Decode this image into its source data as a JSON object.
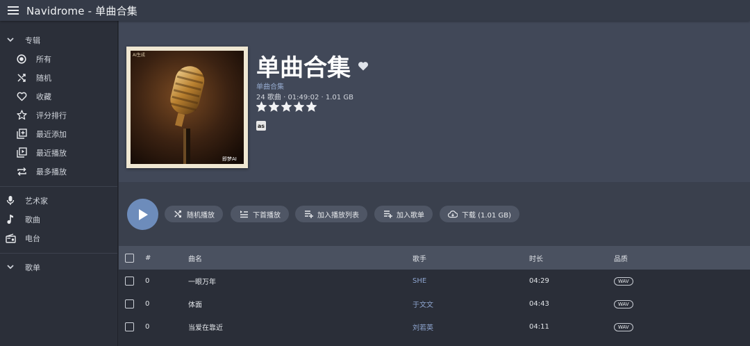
{
  "app": {
    "title": "Navidrome - 单曲合集"
  },
  "sidebar": {
    "albums_section": "专辑",
    "album_items": [
      {
        "label": "所有",
        "icon": "radio-selected-icon"
      },
      {
        "label": "随机",
        "icon": "shuffle-icon"
      },
      {
        "label": "收藏",
        "icon": "heart-outline-icon"
      },
      {
        "label": "评分排行",
        "icon": "star-outline-icon"
      },
      {
        "label": "最近添加",
        "icon": "library-add-icon"
      },
      {
        "label": "最近播放",
        "icon": "video-library-icon"
      },
      {
        "label": "最多播放",
        "icon": "repeat-icon"
      }
    ],
    "top_items": [
      {
        "label": "艺术家",
        "icon": "microphone-icon"
      },
      {
        "label": "歌曲",
        "icon": "music-note-icon"
      },
      {
        "label": "电台",
        "icon": "radio-icon"
      }
    ],
    "playlists_section": "歌单"
  },
  "album": {
    "title": "单曲合集",
    "artist": "单曲合集",
    "meta": "24 歌曲 · 01:49:02 · 1.01 GB",
    "rating": 5,
    "rating_max": 5,
    "lastfm_label": "as",
    "cover_badge": "AI生成",
    "cover_watermark": "即梦AI"
  },
  "actions": {
    "shuffle": "随机播放",
    "play_next": "下首播放",
    "add_to_queue": "加入播放列表",
    "add_to_playlist": "加入歌单",
    "download": "下载 (1.01 GB)"
  },
  "table": {
    "columns": {
      "num": "#",
      "title": "曲名",
      "artist": "歌手",
      "duration": "时长",
      "quality": "品质"
    },
    "rows": [
      {
        "num": "0",
        "title": "一眼万年",
        "artist": "SHE",
        "duration": "04:29",
        "quality": "WAV"
      },
      {
        "num": "0",
        "title": "体面",
        "artist": "于文文",
        "duration": "04:43",
        "quality": "WAV"
      },
      {
        "num": "0",
        "title": "当爱在靠近",
        "artist": "刘若英",
        "duration": "04:11",
        "quality": "WAV"
      }
    ]
  },
  "colors": {
    "accent": "#6d8cbb",
    "link": "#8ea5cf",
    "topbar": "#353b48",
    "sidebar": "#2b2f39",
    "hero": "#414858"
  }
}
